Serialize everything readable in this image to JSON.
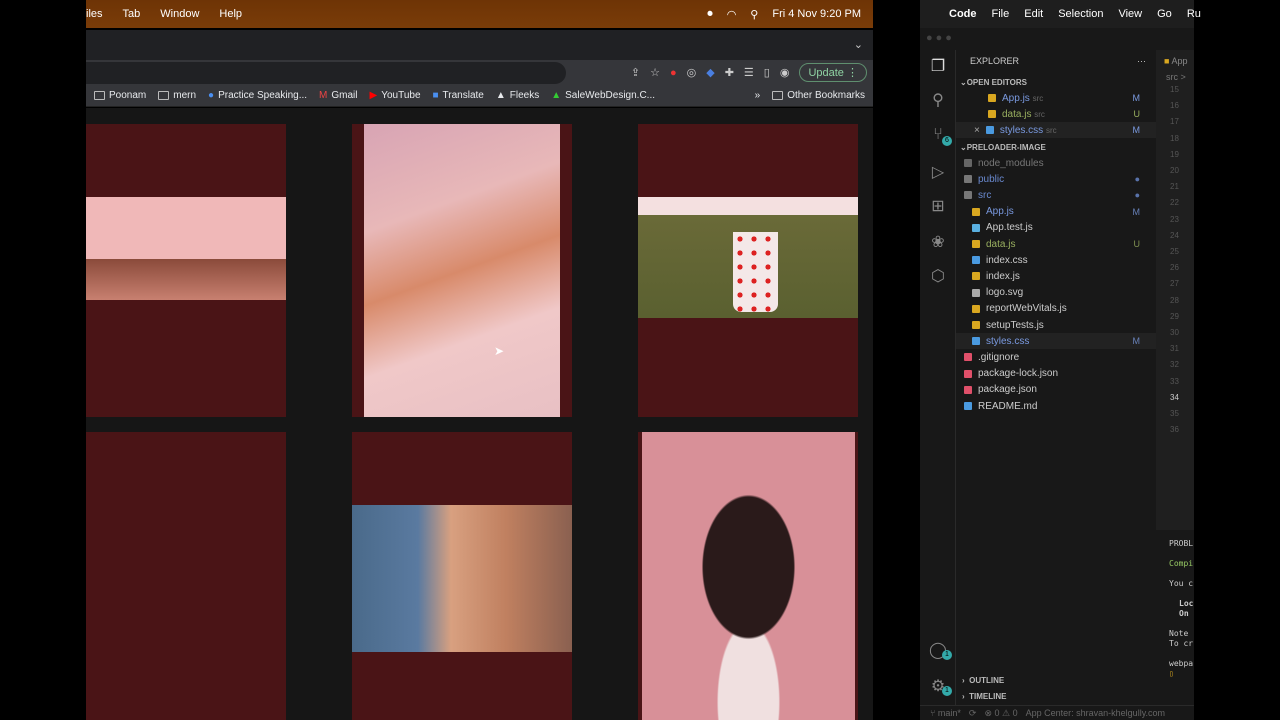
{
  "mac_menu": {
    "items": [
      "iles",
      "Tab",
      "Window",
      "Help"
    ],
    "clock": "Fri 4 Nov  9:20 PM"
  },
  "browser": {
    "update_label": "Update",
    "bookmarks": [
      "Poonam",
      "mern",
      "Practice Speaking...",
      "Gmail",
      "YouTube",
      "Translate",
      "Fleeks",
      "SaleWebDesign.C..."
    ],
    "more": "»",
    "other_bookmarks": "Other Bookmarks"
  },
  "gallery": {
    "accent": "#4a1416",
    "photos": [
      "dog-peeking",
      "shiba-inu",
      "puppy-in-cup",
      "empty",
      "corgi",
      "border-collie"
    ]
  },
  "vscode": {
    "menu": [
      "Code",
      "File",
      "Edit",
      "Selection",
      "View",
      "Go",
      "Ru"
    ],
    "explorer_title": "EXPLORER",
    "more": "···",
    "open_editors_title": "OPEN EDITORS",
    "open_editors": [
      {
        "name": "App.js",
        "dir": "src",
        "badge": "M"
      },
      {
        "name": "data.js",
        "dir": "src",
        "badge": "U"
      },
      {
        "name": "styles.css",
        "dir": "src",
        "badge": "M"
      }
    ],
    "project_title": "PRELOADER-IMAGE",
    "tree": [
      {
        "name": "node_modules",
        "badge": ""
      },
      {
        "name": "public",
        "badge": "●"
      },
      {
        "name": "src",
        "badge": "●"
      },
      {
        "name": "App.js",
        "badge": "M"
      },
      {
        "name": "App.test.js",
        "badge": ""
      },
      {
        "name": "data.js",
        "badge": "U"
      },
      {
        "name": "index.css",
        "badge": ""
      },
      {
        "name": "index.js",
        "badge": ""
      },
      {
        "name": "logo.svg",
        "badge": ""
      },
      {
        "name": "reportWebVitals.js",
        "badge": ""
      },
      {
        "name": "setupTests.js",
        "badge": ""
      },
      {
        "name": "styles.css",
        "badge": "M"
      },
      {
        "name": ".gitignore",
        "badge": ""
      },
      {
        "name": "package-lock.json",
        "badge": ""
      },
      {
        "name": "package.json",
        "badge": ""
      },
      {
        "name": "README.md",
        "badge": ""
      }
    ],
    "outline": "OUTLINE",
    "timeline": "TIMELINE",
    "editor_tab": "App",
    "breadcrumb": "src >",
    "line_numbers": [
      "15",
      "16",
      "17",
      "18",
      "19",
      "20",
      "21",
      "22",
      "23",
      "24",
      "25",
      "26",
      "27",
      "28",
      "29",
      "30",
      "31",
      "32",
      "33",
      "34",
      "35",
      "36"
    ],
    "terminal": [
      "PROBL",
      "Compi",
      "You c",
      "Loc",
      "On",
      "Note",
      "To cr",
      "webpa"
    ],
    "source_control_badge": "6",
    "accounts_badge": "1",
    "settings_badge": "1",
    "status": {
      "branch": "main*",
      "errors": "0",
      "warnings": "0",
      "app_center": "App Center: shravan-khelgully.com"
    }
  }
}
